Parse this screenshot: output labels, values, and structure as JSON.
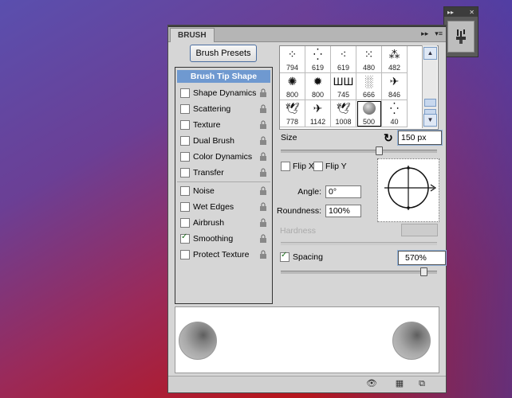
{
  "panel": {
    "tab_label": "BRUSH",
    "collapse_glyph": "▸▸",
    "menu_glyph": "▾≡",
    "presets_button": "Brush Presets"
  },
  "mini_dock": {
    "expand_glyph": "▸▸",
    "close_glyph": "✕"
  },
  "settings_list": {
    "selected": "Brush Tip Shape",
    "items": [
      {
        "label": "Shape Dynamics",
        "checked": false
      },
      {
        "label": "Scattering",
        "checked": false
      },
      {
        "label": "Texture",
        "checked": false
      },
      {
        "label": "Dual Brush",
        "checked": false
      },
      {
        "label": "Color Dynamics",
        "checked": false
      },
      {
        "label": "Transfer",
        "checked": false
      },
      {
        "label": "Noise",
        "checked": false
      },
      {
        "label": "Wet Edges",
        "checked": false
      },
      {
        "label": "Airbrush",
        "checked": false
      },
      {
        "label": "Smoothing",
        "checked": true
      },
      {
        "label": "Protect Texture",
        "checked": false
      }
    ]
  },
  "brush_tips": {
    "row1": [
      "794",
      "619",
      "619",
      "480",
      "482"
    ],
    "row2": [
      "800",
      "800",
      "745",
      "666",
      "846"
    ],
    "row3": [
      "778",
      "1142",
      "1008",
      "500",
      "40"
    ],
    "selected": "500"
  },
  "tip_shape": {
    "size_label": "Size",
    "size_value": "150 px",
    "flip_x": "Flip X",
    "flip_y": "Flip Y",
    "angle_label": "Angle:",
    "angle_value": "0°",
    "roundness_label": "Roundness:",
    "roundness_value": "100%",
    "hardness_label": "Hardness",
    "spacing_label": "Spacing",
    "spacing_value": "570%",
    "spacing_checked": true
  }
}
